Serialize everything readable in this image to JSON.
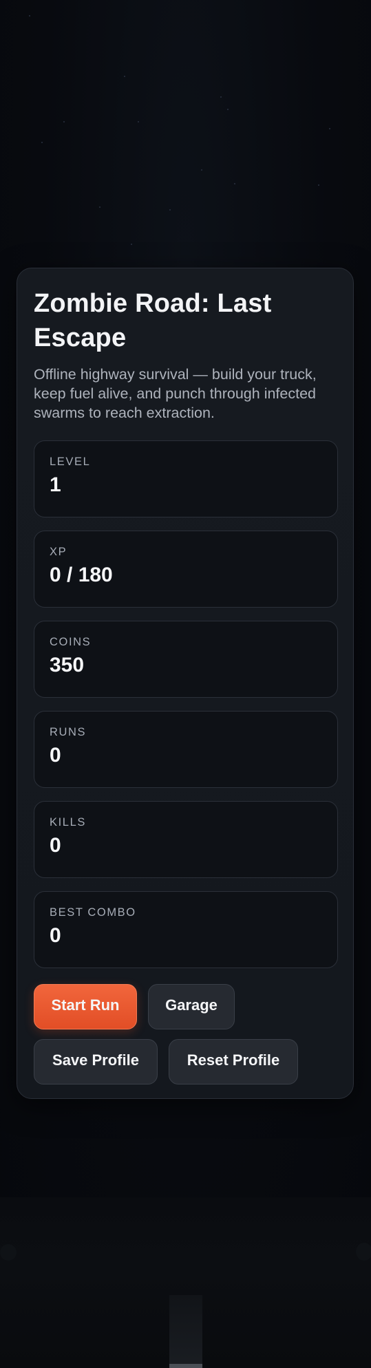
{
  "app": {
    "title": "Zombie Road: Last Escape",
    "subtitle": "Offline highway survival — build your truck, keep fuel alive, and punch through infected swarms to reach extraction."
  },
  "stats": [
    {
      "label": "LEVEL",
      "value": "1"
    },
    {
      "label": "XP",
      "value": "0 / 180"
    },
    {
      "label": "COINS",
      "value": "350"
    },
    {
      "label": "RUNS",
      "value": "0"
    },
    {
      "label": "KILLS",
      "value": "0"
    },
    {
      "label": "BEST COMBO",
      "value": "0"
    }
  ],
  "buttons": {
    "start_run": "Start Run",
    "garage": "Garage",
    "save_profile": "Save Profile",
    "reset_profile": "Reset Profile"
  },
  "colors": {
    "accent": "#ef5e33",
    "panel": "#161a20",
    "background": "#07090d"
  }
}
